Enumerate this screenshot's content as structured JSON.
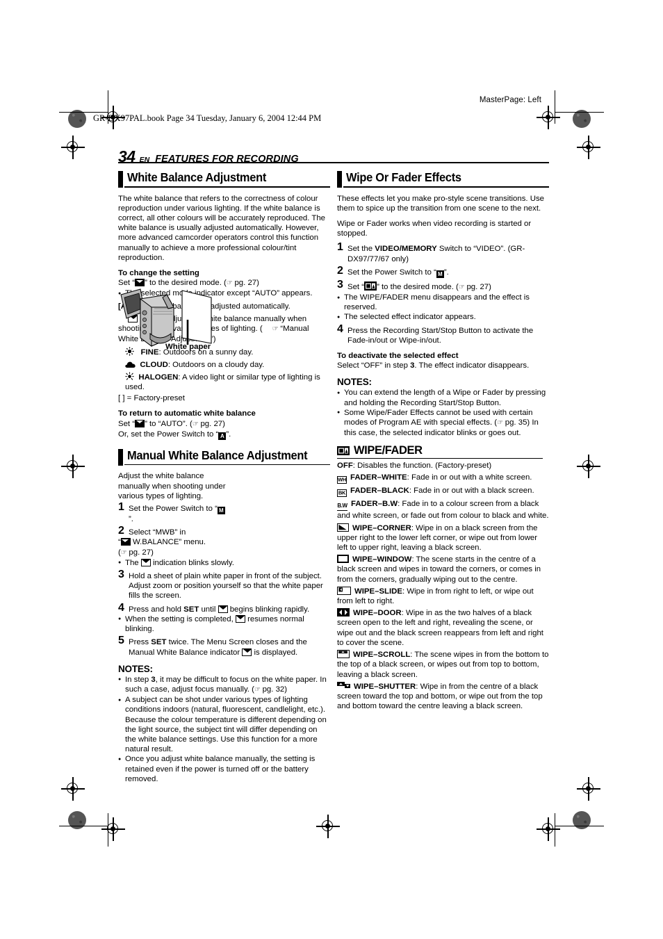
{
  "printer_marks": {
    "master_page": "MasterPage: Left",
    "file_stamp": "GR-DX97PAL.book  Page 34  Tuesday, January 6, 2004  12:44 PM"
  },
  "page_header": {
    "page_number": "34",
    "locale": "EN",
    "section_title": "FEATURES FOR RECORDING"
  },
  "left_column": {
    "section1": {
      "title": "White Balance Adjustment",
      "intro": "The white balance that refers to the correctness of colour reproduction under various lighting. If the white balance is correct, all other colours will be accurately reproduced. The white balance is usually adjusted automatically. However, more advanced camcorder operators control this function manually to achieve a more professional colour/tint reproduction.",
      "sub1_title": "To change the setting",
      "sub1_line1_pre": "Set “",
      "sub1_line1_post": "” to the desired mode. (",
      "sub1_line1_ref": " pg. 27)",
      "sub1_bullet": "The selected mode indicator except “AUTO” appears.",
      "auto_label": "[AUTO]",
      "auto_text": ": White balance is adjusted automatically.",
      "mwb_label": "MWB",
      "mwb_text": ": Adjust the white balance manually when shooting under various types of lighting. (",
      "mwb_ref": " “Manual White Balance Adjustment”)",
      "fine_label": "FINE",
      "fine_text": ": Outdoors on a sunny day.",
      "cloud_label": "CLOUD",
      "cloud_text": ": Outdoors on a cloudy day.",
      "halogen_label": "HALOGEN",
      "halogen_text": ": A video light or similar type of lighting is used.",
      "factory_preset": "[  ] = Factory-preset",
      "sub2_title": "To return to automatic white balance",
      "sub2_line1_pre": "Set “",
      "sub2_line1_post": "” to “AUTO”. (",
      "sub2_line1_ref": " pg. 27)",
      "sub2_line2_pre": "Or, set the Power Switch to “",
      "sub2_line2_post": "”."
    },
    "section2": {
      "title": "Manual White Balance Adjustment",
      "intro": "Adjust the white balance manually when shooting under various types of lighting.",
      "illustration_caption": "White paper",
      "step1_num": "1",
      "step1_pre": "Set the Power Switch to “",
      "step1_post": "”.",
      "step2_num": "2",
      "step2_line1": "Select “MWB” in",
      "step2_line2_pre": "“",
      "step2_line2_post": " W.BALANCE” menu.",
      "step2_line3_ref": " pg. 27)",
      "step2_bullet_pre": "The ",
      "step2_bullet_post": " indication blinks slowly.",
      "step3_num": "3",
      "step3_text": "Hold a sheet of plain white paper in front of the subject. Adjust zoom or position yourself so that the white paper fills the screen.",
      "step4_num": "4",
      "step4_pre": "Press and hold ",
      "step4_bold": "SET",
      "step4_mid": " until ",
      "step4_post": " begins blinking rapidly.",
      "step4_bullet_pre": "When the setting is completed, ",
      "step4_bullet_post": " resumes normal blinking.",
      "step5_num": "5",
      "step5_pre": "Press ",
      "step5_bold": "SET",
      "step5_mid": " twice. The Menu Screen closes and the Manual White Balance indicator ",
      "step5_post": " is displayed.",
      "notes_title": "NOTES:",
      "notes": [
        {
          "pre": "In step ",
          "bold": "3",
          "mid": ", it may be difficult to focus on the white paper. In such a case, adjust focus manually. (",
          "ref": " pg. 32)"
        },
        {
          "text": "A subject can be shot under various types of lighting conditions indoors (natural, fluorescent, candlelight, etc.). Because the colour temperature is different depending on the light source, the subject tint will differ depending on the white balance settings. Use this function for a more natural result."
        },
        {
          "text": "Once you adjust white balance manually, the setting is retained even if the power is turned off or the battery removed."
        }
      ]
    }
  },
  "right_column": {
    "section1": {
      "title": "Wipe Or Fader Effects",
      "intro1": "These effects let you make pro-style scene transitions. Use them to spice up the transition from one scene to the next.",
      "intro2": "Wipe or Fader works when video recording is started or stopped.",
      "step1_num": "1",
      "step1_pre": "Set the ",
      "step1_bold": "VIDEO/MEMORY",
      "step1_post": " Switch to “VIDEO”. (GR-DX97/77/67 only)",
      "step2_num": "2",
      "step2_pre": "Set the Power Switch to “",
      "step2_post": "”.",
      "step3_num": "3",
      "step3_pre": "Set “",
      "step3_post": "” to the desired mode. (",
      "step3_ref": " pg. 27)",
      "step3_bullets": [
        "The WIPE/FADER menu disappears and the effect is reserved.",
        "The selected effect indicator appears."
      ],
      "step4_num": "4",
      "step4_text": "Press the Recording Start/Stop Button to activate the Fade-in/out or Wipe-in/out.",
      "deact_title": "To deactivate the selected effect",
      "deact_pre": "Select “OFF” in step ",
      "deact_bold": "3",
      "deact_post": ". The effect indicator disappears.",
      "notes_title": "NOTES:",
      "notes": [
        {
          "text": "You can extend the length of a Wipe or Fader by pressing and holding the Recording Start/Stop Button."
        },
        {
          "pre": "Some Wipe/Fader Effects cannot be used with certain modes of Program AE with special effects. (",
          "ref": " pg. 35)",
          "post": " In this case, the selected indicator blinks or goes out."
        }
      ]
    },
    "wipe_fader": {
      "title": "WIPE/FADER",
      "items": [
        {
          "icon": "none",
          "label": "OFF",
          "text": ": Disables the function. (Factory-preset)"
        },
        {
          "icon": "fader-white-icon",
          "icon_text": "WH",
          "label": "FADER–WHITE",
          "text": ": Fade in or out with a white screen."
        },
        {
          "icon": "fader-black-icon",
          "icon_text": "BK",
          "label": "FADER–BLACK",
          "text": ": Fade in or out with a black screen."
        },
        {
          "icon": "fader-bw-icon",
          "icon_text": "B.W",
          "label": "FADER–B.W",
          "text": ": Fade in to a colour screen from a black and white screen, or fade out from colour to black and white."
        },
        {
          "icon": "wipe-corner-icon",
          "label": "WIPE–CORNER",
          "text": ": Wipe in on a black screen from the upper right to the lower left corner, or wipe out from lower left to upper right, leaving a black screen."
        },
        {
          "icon": "wipe-window-icon",
          "label": "WIPE–WINDOW",
          "text": ": The scene starts in the centre of a black screen and wipes in toward the corners, or comes in from the corners, gradually wiping out to the centre."
        },
        {
          "icon": "wipe-slide-icon",
          "label": "WIPE–SLIDE",
          "text": ": Wipe in from right to left, or wipe out from left to right."
        },
        {
          "icon": "wipe-door-icon",
          "label": "WIPE–DOOR",
          "text": ": Wipe in as the two halves of a black screen open to the left and right, revealing the scene, or wipe out and the black screen reappears from left and right to cover the scene."
        },
        {
          "icon": "wipe-scroll-icon",
          "label": "WIPE–SCROLL",
          "text": ": The scene wipes in from the bottom to the top of a black screen, or wipes out from top to bottom, leaving a black screen."
        },
        {
          "icon": "wipe-shutter-icon",
          "label": "WIPE–SHUTTER",
          "text": ": Wipe in from the centre of a black screen toward the top and bottom, or wipe out from the top and bottom toward the centre leaving a black screen."
        }
      ]
    }
  },
  "icon_glyphs": {
    "power_m": "M",
    "power_a": "A",
    "page_ref_hand": "☞"
  }
}
